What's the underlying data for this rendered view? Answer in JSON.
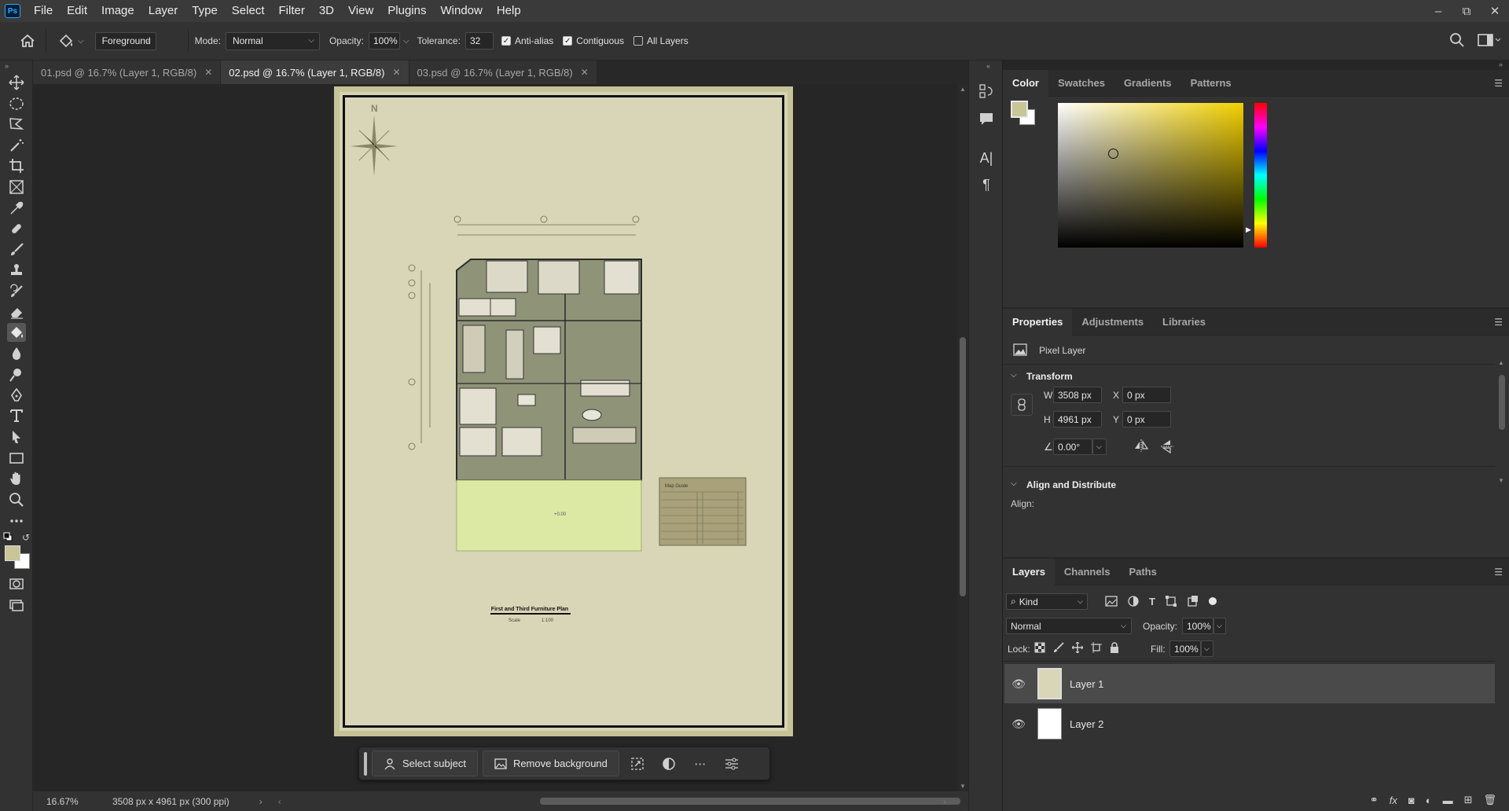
{
  "app": {
    "logo": "Ps"
  },
  "menu": [
    "File",
    "Edit",
    "Image",
    "Layer",
    "Type",
    "Select",
    "Filter",
    "3D",
    "View",
    "Plugins",
    "Window",
    "Help"
  ],
  "window_controls": {
    "minimize": "–",
    "restore": "⧉",
    "close": "✕"
  },
  "options": {
    "fill_source": "Foreground",
    "mode_label": "Mode:",
    "mode_value": "Normal",
    "opacity_label": "Opacity:",
    "opacity_value": "100%",
    "tolerance_label": "Tolerance:",
    "tolerance_value": "32",
    "anti_alias": "Anti-alias",
    "contiguous": "Contiguous",
    "all_layers": "All Layers"
  },
  "tabs": [
    {
      "label": "01.psd @ 16.7% (Layer 1, RGB/8)",
      "active": false
    },
    {
      "label": "02.psd @ 16.7% (Layer 1, RGB/8)",
      "active": true
    },
    {
      "label": "03.psd @ 16.7% (Layer 1, RGB/8)",
      "active": false
    }
  ],
  "status": {
    "zoom": "16.67%",
    "doc_info": "3508 px x 4961 px (300 ppi)"
  },
  "taskbar": {
    "select_subject": "Select subject",
    "remove_background": "Remove background"
  },
  "drawing": {
    "north": "N",
    "plan_title": "First and Third Furniture Plan",
    "scale_label": "Scale",
    "scale_value": "1:100",
    "legend_title": "Map Guide"
  },
  "color_panel": {
    "tabs": [
      "Color",
      "Swatches",
      "Gradients",
      "Patterns"
    ],
    "foreground": "#c8c597",
    "background": "#ffffff"
  },
  "properties": {
    "tabs": [
      "Properties",
      "Adjustments",
      "Libraries"
    ],
    "type": "Pixel Layer",
    "transform_title": "Transform",
    "w_label": "W",
    "w": "3508 px",
    "h_label": "H",
    "h": "4961 px",
    "x_label": "X",
    "x": "0 px",
    "y_label": "Y",
    "y": "0 px",
    "angle": "0.00°",
    "align_title": "Align and Distribute",
    "align_label": "Align:"
  },
  "layers": {
    "tabs": [
      "Layers",
      "Channels",
      "Paths"
    ],
    "kind": "Kind",
    "blend": "Normal",
    "opacity_label": "Opacity:",
    "opacity": "100%",
    "lock_label": "Lock:",
    "fill_label": "Fill:",
    "fill": "100%",
    "items": [
      {
        "name": "Layer 1",
        "selected": true
      },
      {
        "name": "Layer 2",
        "selected": false
      }
    ]
  }
}
